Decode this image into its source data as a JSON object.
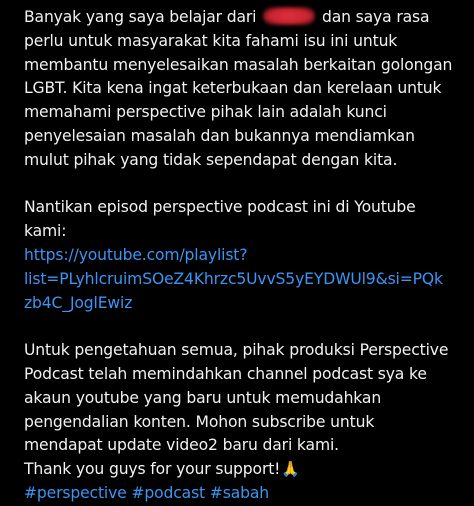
{
  "post": {
    "p1": {
      "l1_before": "Banyak yang saya belajar dari",
      "l1_after": "dan saya rasa",
      "l2": "perlu untuk masyarakat kita fahami isu ini untuk",
      "l3": "membantu menyelesaikan masalah berkaitan golongan",
      "l4": "LGBT. Kita kena ingat keterbukaan dan kerelaan untuk",
      "l5": "memahami perspective pihak lain adalah kunci",
      "l6": "penyelesaian masalah dan bukannya mendiamkan",
      "l7": "mulut pihak yang tidak sependapat dengan kita."
    },
    "p2": {
      "l1": "Nantikan episod perspective podcast ini di Youtube",
      "l2": "kami:",
      "link_l1": "https://youtube.com/playlist?",
      "link_l2": "list=PLyhlcruimSOeZ4Khrzc5UvvS5yEYDWUl9&si=PQk",
      "link_l3": "zb4C_JoglEwiz"
    },
    "p3": {
      "l1": "Untuk pengetahuan semua, pihak produksi Perspective",
      "l2": "Podcast telah memindahkan channel podcast sya ke",
      "l3": "akaun youtube yang baru untuk memudahkan",
      "l4": "pengendalian konten. Mohon subscribe untuk",
      "l5": "mendapat update video2 baru dari kami.",
      "l6": "Thank you guys for your support!",
      "emoji": "🙏",
      "hashtags": "#perspective #podcast #sabah"
    }
  },
  "colors": {
    "background": "#000000",
    "text": "#f2f2f2",
    "link": "#3b95f5",
    "redaction": "#d32a36"
  }
}
